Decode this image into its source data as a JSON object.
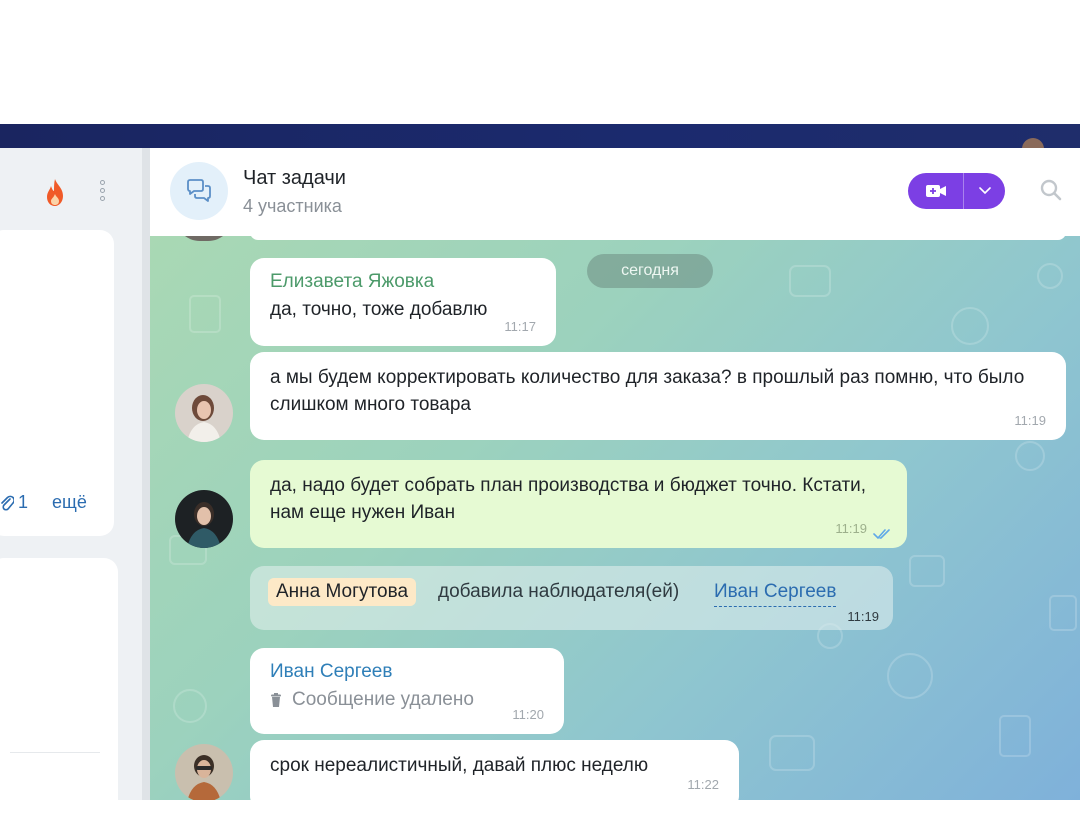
{
  "chat": {
    "title": "Чат задачи",
    "subtitle": "4 участника"
  },
  "left_panel": {
    "attachments_count": "1",
    "more_label": "ещё"
  },
  "date_separator": "сегодня",
  "messages": [
    {
      "sender": "Елизавета Яжовка",
      "text": "да, точно, тоже добавлю",
      "time": "11:17"
    },
    {
      "text": "а мы будем корректировать количество для заказа? в прошлый раз помню, что было слишком много товара",
      "time": "11:19"
    },
    {
      "text": "да, надо будет собрать план производства и бюджет точно. Кстати, нам еще нужен Иван",
      "time": "11:19"
    },
    {
      "sender": "Иван Сергеев",
      "text": "Сообщение удалено",
      "time": "11:20"
    },
    {
      "text": "срок нереалистичный, давай плюс неделю",
      "time": "11:22"
    }
  ],
  "system_event": {
    "actor": "Анна Могутова",
    "action": "добавила наблюдателя(ей)",
    "target": "Иван Сергеев",
    "time": "11:19"
  },
  "icons": [
    "chat-icon",
    "fire-icon",
    "kebab-icon",
    "paperclip-icon",
    "video-camera-icon",
    "chevron-down-icon",
    "search-icon",
    "trash-icon",
    "double-check-icon"
  ],
  "colors": {
    "accent_purple": "#7c3fe4",
    "sender_green": "#4c9a6a",
    "sender_blue": "#2f7fb8",
    "link_blue": "#2b6cb0",
    "own_bubble": "#e6fad3",
    "fire": "#f05a28"
  }
}
